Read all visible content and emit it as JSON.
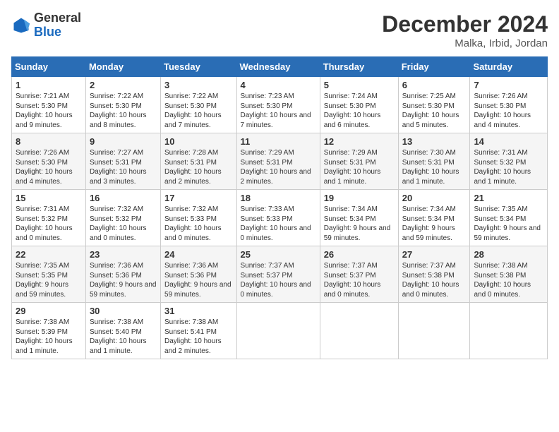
{
  "header": {
    "logo_general": "General",
    "logo_blue": "Blue",
    "month_title": "December 2024",
    "location": "Malka, Irbid, Jordan"
  },
  "weekdays": [
    "Sunday",
    "Monday",
    "Tuesday",
    "Wednesday",
    "Thursday",
    "Friday",
    "Saturday"
  ],
  "weeks": [
    [
      {
        "day": "1",
        "sunrise": "Sunrise: 7:21 AM",
        "sunset": "Sunset: 5:30 PM",
        "daylight": "Daylight: 10 hours and 9 minutes."
      },
      {
        "day": "2",
        "sunrise": "Sunrise: 7:22 AM",
        "sunset": "Sunset: 5:30 PM",
        "daylight": "Daylight: 10 hours and 8 minutes."
      },
      {
        "day": "3",
        "sunrise": "Sunrise: 7:22 AM",
        "sunset": "Sunset: 5:30 PM",
        "daylight": "Daylight: 10 hours and 7 minutes."
      },
      {
        "day": "4",
        "sunrise": "Sunrise: 7:23 AM",
        "sunset": "Sunset: 5:30 PM",
        "daylight": "Daylight: 10 hours and 7 minutes."
      },
      {
        "day": "5",
        "sunrise": "Sunrise: 7:24 AM",
        "sunset": "Sunset: 5:30 PM",
        "daylight": "Daylight: 10 hours and 6 minutes."
      },
      {
        "day": "6",
        "sunrise": "Sunrise: 7:25 AM",
        "sunset": "Sunset: 5:30 PM",
        "daylight": "Daylight: 10 hours and 5 minutes."
      },
      {
        "day": "7",
        "sunrise": "Sunrise: 7:26 AM",
        "sunset": "Sunset: 5:30 PM",
        "daylight": "Daylight: 10 hours and 4 minutes."
      }
    ],
    [
      {
        "day": "8",
        "sunrise": "Sunrise: 7:26 AM",
        "sunset": "Sunset: 5:30 PM",
        "daylight": "Daylight: 10 hours and 4 minutes."
      },
      {
        "day": "9",
        "sunrise": "Sunrise: 7:27 AM",
        "sunset": "Sunset: 5:31 PM",
        "daylight": "Daylight: 10 hours and 3 minutes."
      },
      {
        "day": "10",
        "sunrise": "Sunrise: 7:28 AM",
        "sunset": "Sunset: 5:31 PM",
        "daylight": "Daylight: 10 hours and 2 minutes."
      },
      {
        "day": "11",
        "sunrise": "Sunrise: 7:29 AM",
        "sunset": "Sunset: 5:31 PM",
        "daylight": "Daylight: 10 hours and 2 minutes."
      },
      {
        "day": "12",
        "sunrise": "Sunrise: 7:29 AM",
        "sunset": "Sunset: 5:31 PM",
        "daylight": "Daylight: 10 hours and 1 minute."
      },
      {
        "day": "13",
        "sunrise": "Sunrise: 7:30 AM",
        "sunset": "Sunset: 5:31 PM",
        "daylight": "Daylight: 10 hours and 1 minute."
      },
      {
        "day": "14",
        "sunrise": "Sunrise: 7:31 AM",
        "sunset": "Sunset: 5:32 PM",
        "daylight": "Daylight: 10 hours and 1 minute."
      }
    ],
    [
      {
        "day": "15",
        "sunrise": "Sunrise: 7:31 AM",
        "sunset": "Sunset: 5:32 PM",
        "daylight": "Daylight: 10 hours and 0 minutes."
      },
      {
        "day": "16",
        "sunrise": "Sunrise: 7:32 AM",
        "sunset": "Sunset: 5:32 PM",
        "daylight": "Daylight: 10 hours and 0 minutes."
      },
      {
        "day": "17",
        "sunrise": "Sunrise: 7:32 AM",
        "sunset": "Sunset: 5:33 PM",
        "daylight": "Daylight: 10 hours and 0 minutes."
      },
      {
        "day": "18",
        "sunrise": "Sunrise: 7:33 AM",
        "sunset": "Sunset: 5:33 PM",
        "daylight": "Daylight: 10 hours and 0 minutes."
      },
      {
        "day": "19",
        "sunrise": "Sunrise: 7:34 AM",
        "sunset": "Sunset: 5:34 PM",
        "daylight": "Daylight: 9 hours and 59 minutes."
      },
      {
        "day": "20",
        "sunrise": "Sunrise: 7:34 AM",
        "sunset": "Sunset: 5:34 PM",
        "daylight": "Daylight: 9 hours and 59 minutes."
      },
      {
        "day": "21",
        "sunrise": "Sunrise: 7:35 AM",
        "sunset": "Sunset: 5:34 PM",
        "daylight": "Daylight: 9 hours and 59 minutes."
      }
    ],
    [
      {
        "day": "22",
        "sunrise": "Sunrise: 7:35 AM",
        "sunset": "Sunset: 5:35 PM",
        "daylight": "Daylight: 9 hours and 59 minutes."
      },
      {
        "day": "23",
        "sunrise": "Sunrise: 7:36 AM",
        "sunset": "Sunset: 5:36 PM",
        "daylight": "Daylight: 9 hours and 59 minutes."
      },
      {
        "day": "24",
        "sunrise": "Sunrise: 7:36 AM",
        "sunset": "Sunset: 5:36 PM",
        "daylight": "Daylight: 9 hours and 59 minutes."
      },
      {
        "day": "25",
        "sunrise": "Sunrise: 7:37 AM",
        "sunset": "Sunset: 5:37 PM",
        "daylight": "Daylight: 10 hours and 0 minutes."
      },
      {
        "day": "26",
        "sunrise": "Sunrise: 7:37 AM",
        "sunset": "Sunset: 5:37 PM",
        "daylight": "Daylight: 10 hours and 0 minutes."
      },
      {
        "day": "27",
        "sunrise": "Sunrise: 7:37 AM",
        "sunset": "Sunset: 5:38 PM",
        "daylight": "Daylight: 10 hours and 0 minutes."
      },
      {
        "day": "28",
        "sunrise": "Sunrise: 7:38 AM",
        "sunset": "Sunset: 5:38 PM",
        "daylight": "Daylight: 10 hours and 0 minutes."
      }
    ],
    [
      {
        "day": "29",
        "sunrise": "Sunrise: 7:38 AM",
        "sunset": "Sunset: 5:39 PM",
        "daylight": "Daylight: 10 hours and 1 minute."
      },
      {
        "day": "30",
        "sunrise": "Sunrise: 7:38 AM",
        "sunset": "Sunset: 5:40 PM",
        "daylight": "Daylight: 10 hours and 1 minute."
      },
      {
        "day": "31",
        "sunrise": "Sunrise: 7:38 AM",
        "sunset": "Sunset: 5:41 PM",
        "daylight": "Daylight: 10 hours and 2 minutes."
      },
      null,
      null,
      null,
      null
    ]
  ]
}
